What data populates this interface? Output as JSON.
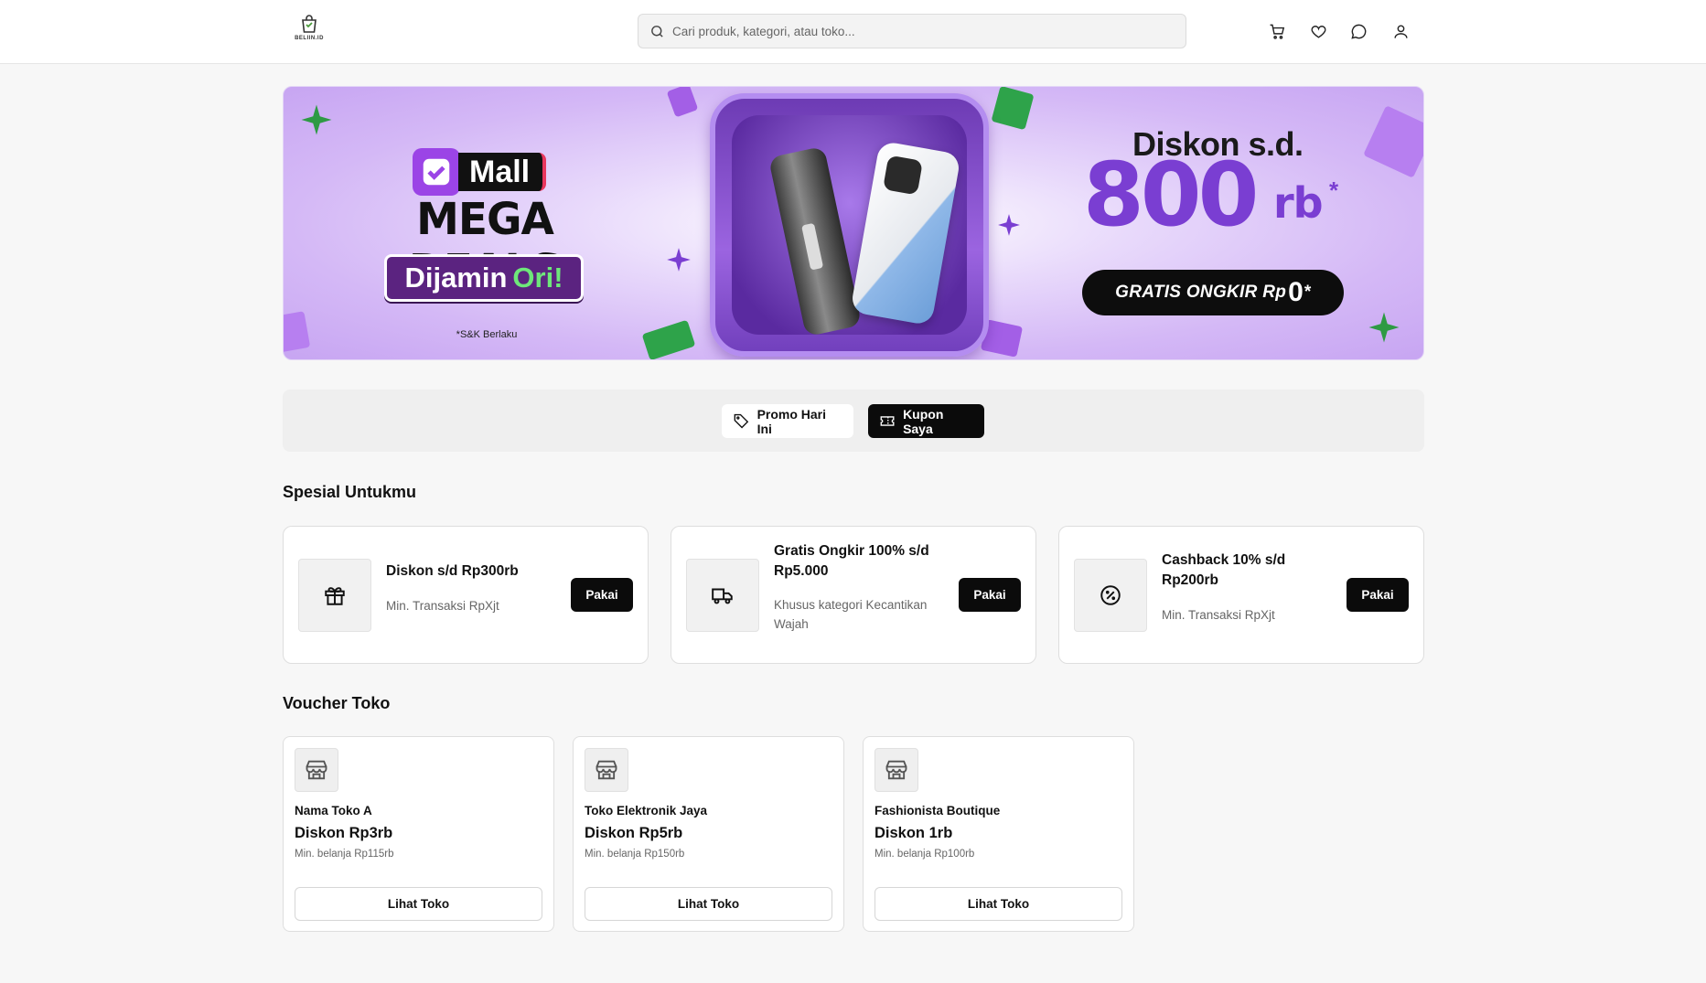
{
  "header": {
    "logo_text": "BELIIN.ID",
    "search": {
      "placeholder": "Cari produk, kategori, atau toko...",
      "value": ""
    },
    "icons": [
      "cart-icon",
      "heart-icon",
      "chat-icon",
      "user-icon"
    ]
  },
  "banner": {
    "mall_label": "Mall",
    "headline": "MEGA DEALS",
    "badge_prefix": "Dijamin",
    "badge_suffix": "Ori!",
    "terms": "*S&K Berlaku",
    "discount_prefix": "Diskon s.d.",
    "discount_amount": "800",
    "discount_unit": "rb",
    "discount_asterisk": "*",
    "shipping_text": "GRATIS ONGKIR Rp",
    "shipping_zero": "0",
    "shipping_asterisk": "*",
    "colors": {
      "accent_purple": "#7a3ed2",
      "green": "#6ee77a"
    }
  },
  "tabs": [
    {
      "label": "Promo Hari Ini",
      "icon": "tag-icon",
      "active": false
    },
    {
      "label": "Kupon Saya",
      "icon": "ticket-icon",
      "active": true
    }
  ],
  "special": {
    "title": "Spesial Untukmu",
    "cards": [
      {
        "icon": "gift-icon",
        "title": "Diskon s/d Rp300rb",
        "subtitle": "Min. Transaksi RpXjt",
        "button": "Pakai"
      },
      {
        "icon": "truck-icon",
        "title": "Gratis Ongkir 100% s/d Rp5.000",
        "subtitle": "Khusus kategori Kecantikan Wajah",
        "button": "Pakai"
      },
      {
        "icon": "percent-icon",
        "title": "Cashback 10% s/d Rp200rb",
        "subtitle": "Min. Transaksi RpXjt",
        "button": "Pakai"
      }
    ]
  },
  "vouchers": {
    "title": "Voucher Toko",
    "cards": [
      {
        "icon": "store-icon",
        "store": "Nama Toko A",
        "discount": "Diskon Rp3rb",
        "min": "Min. belanja Rp115rb",
        "button": "Lihat Toko"
      },
      {
        "icon": "store-icon",
        "store": "Toko Elektronik Jaya",
        "discount": "Diskon Rp5rb",
        "min": "Min. belanja Rp150rb",
        "button": "Lihat Toko"
      },
      {
        "icon": "store-icon",
        "store": "Fashionista Boutique",
        "discount": "Diskon 1rb",
        "min": "Min. belanja Rp100rb",
        "button": "Lihat Toko"
      }
    ]
  }
}
